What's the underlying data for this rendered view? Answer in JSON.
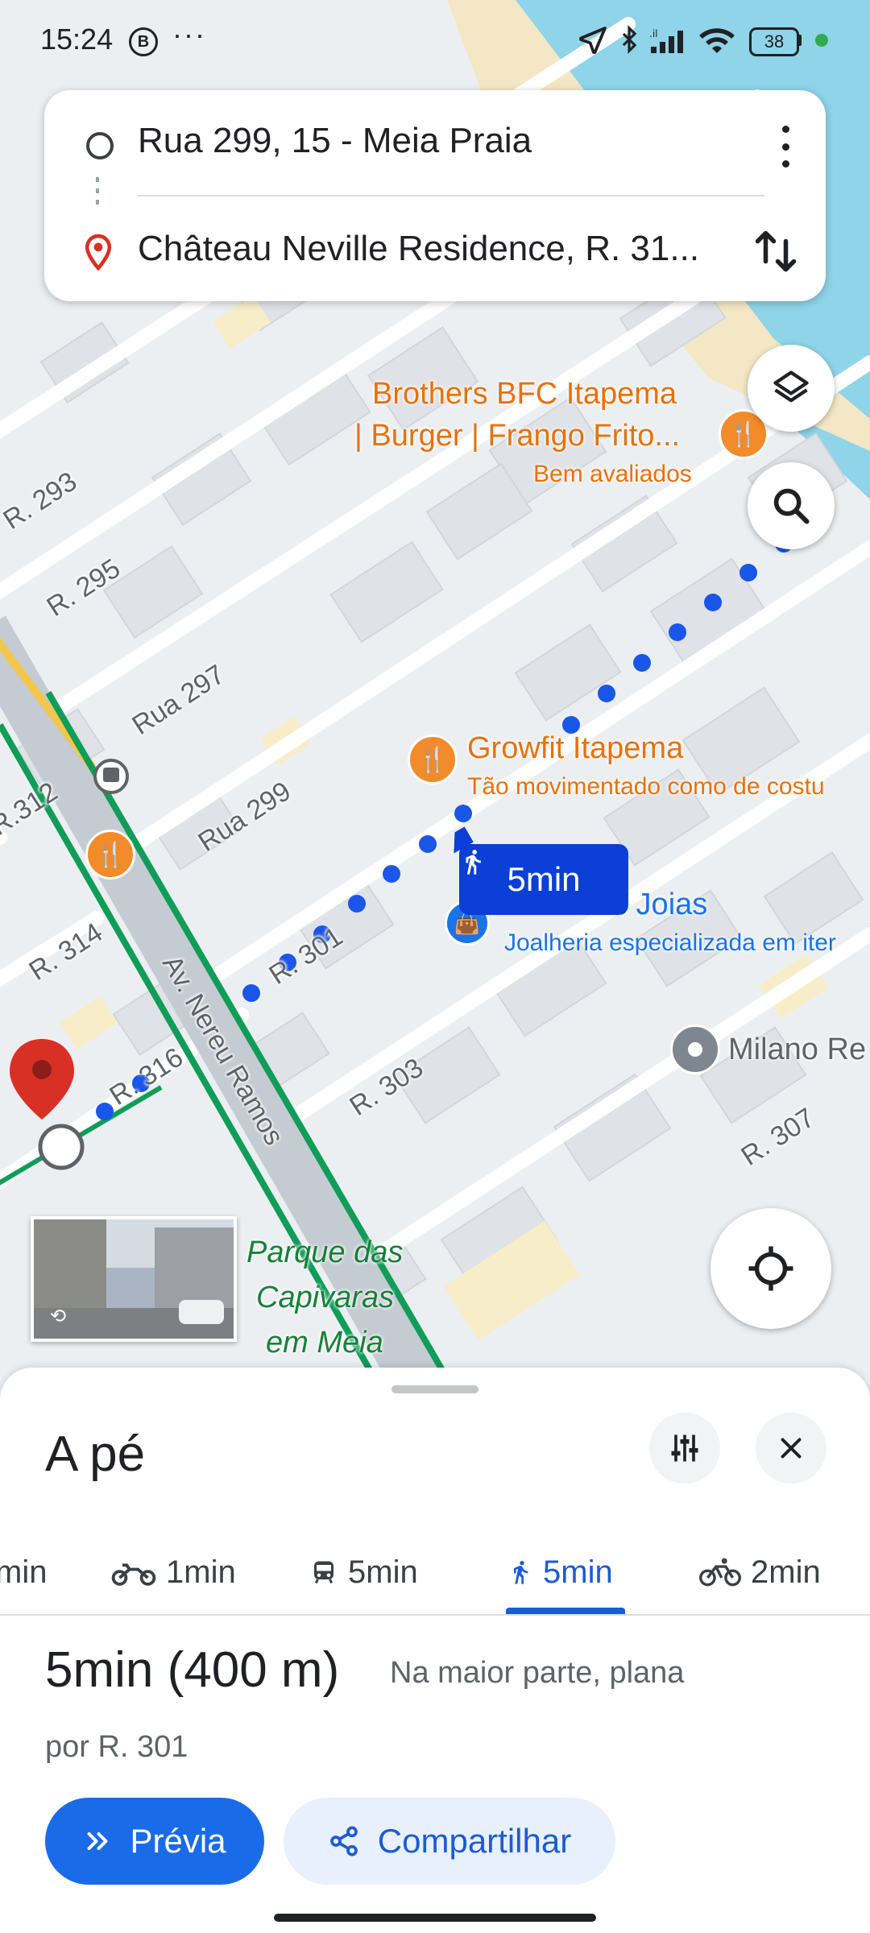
{
  "status_bar": {
    "time": "15:24",
    "battery": "38",
    "icons": [
      "b-circle-icon",
      "more-dots-icon",
      "location-arrow-icon",
      "bluetooth-icon",
      "signal-icon",
      "wifi-icon",
      "battery-icon",
      "green-dot-icon"
    ]
  },
  "directions": {
    "origin": "Rua 299, 15 - Meia Praia",
    "destination": "Château Neville Residence, R. 31..."
  },
  "map": {
    "streets": [
      "R. 293",
      "R. 295",
      "Rua 297",
      "Rua 299",
      "R. 301",
      "R. 303",
      "R. 307",
      "R.312",
      "R. 314",
      "R. 316",
      "Av. Nereu Ramos"
    ],
    "pois": [
      {
        "title_line1": "Brothers BFC Itapema",
        "title_line2": "| Burger | Frango Frito...",
        "subtitle": "Bem avaliados"
      },
      {
        "title": "Growfit Itapema",
        "subtitle": "Tão movimentado como de costu"
      },
      {
        "title": "s Joias",
        "subtitle": "Joalheria especializada em iter"
      },
      {
        "title": "Milano Re"
      }
    ],
    "park": [
      "Parque das",
      "Capivaras",
      "em Meia"
    ],
    "walk_badge": "5min",
    "route_color": "#1a56e8"
  },
  "sheet": {
    "mode_title": "A pé",
    "tabs": [
      {
        "label": "min",
        "icon": "car-icon"
      },
      {
        "label": "1min",
        "icon": "motorcycle-icon"
      },
      {
        "label": "5min",
        "icon": "transit-icon"
      },
      {
        "label": "5min",
        "icon": "walk-icon",
        "active": true
      },
      {
        "label": "2min",
        "icon": "bicycle-icon"
      }
    ],
    "summary_time": "5min (400 m)",
    "summary_note": "Na maior parte, plana",
    "via": "por R. 301",
    "preview_label": "Prévia",
    "share_label": "Compartilhar"
  },
  "colors": {
    "accent": "#1a6be8",
    "poi_orange": "#e8710a",
    "road_green": "#0f9d58",
    "water": "#8fd4e8"
  }
}
